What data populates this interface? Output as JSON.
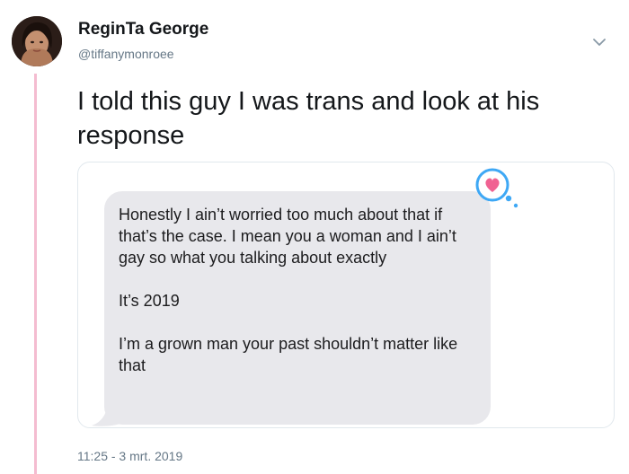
{
  "user": {
    "display_name": "ReginTa George",
    "handle": "@tiffanymonroee"
  },
  "tweet": {
    "text": "I told this guy I was trans and look at his response",
    "timestamp": "11:25 - 3 mrt. 2019"
  },
  "message": {
    "paragraphs": [
      "Honestly I ain’t worried too much about that if that’s the case. I mean you a woman and I ain’t gay so what you talking about exactly",
      "It’s 2019",
      "I’m a grown man your past shouldn’t matter like that"
    ],
    "reaction_icon": "heart-icon"
  },
  "icons": {
    "menu": "chevron-down-icon"
  },
  "colors": {
    "thread_line": "#f4bcd0",
    "bubble": "#e8e8ec",
    "reaction_badge": "#3ea8f5",
    "heart": "#f06292",
    "secondary_text": "#657786"
  }
}
